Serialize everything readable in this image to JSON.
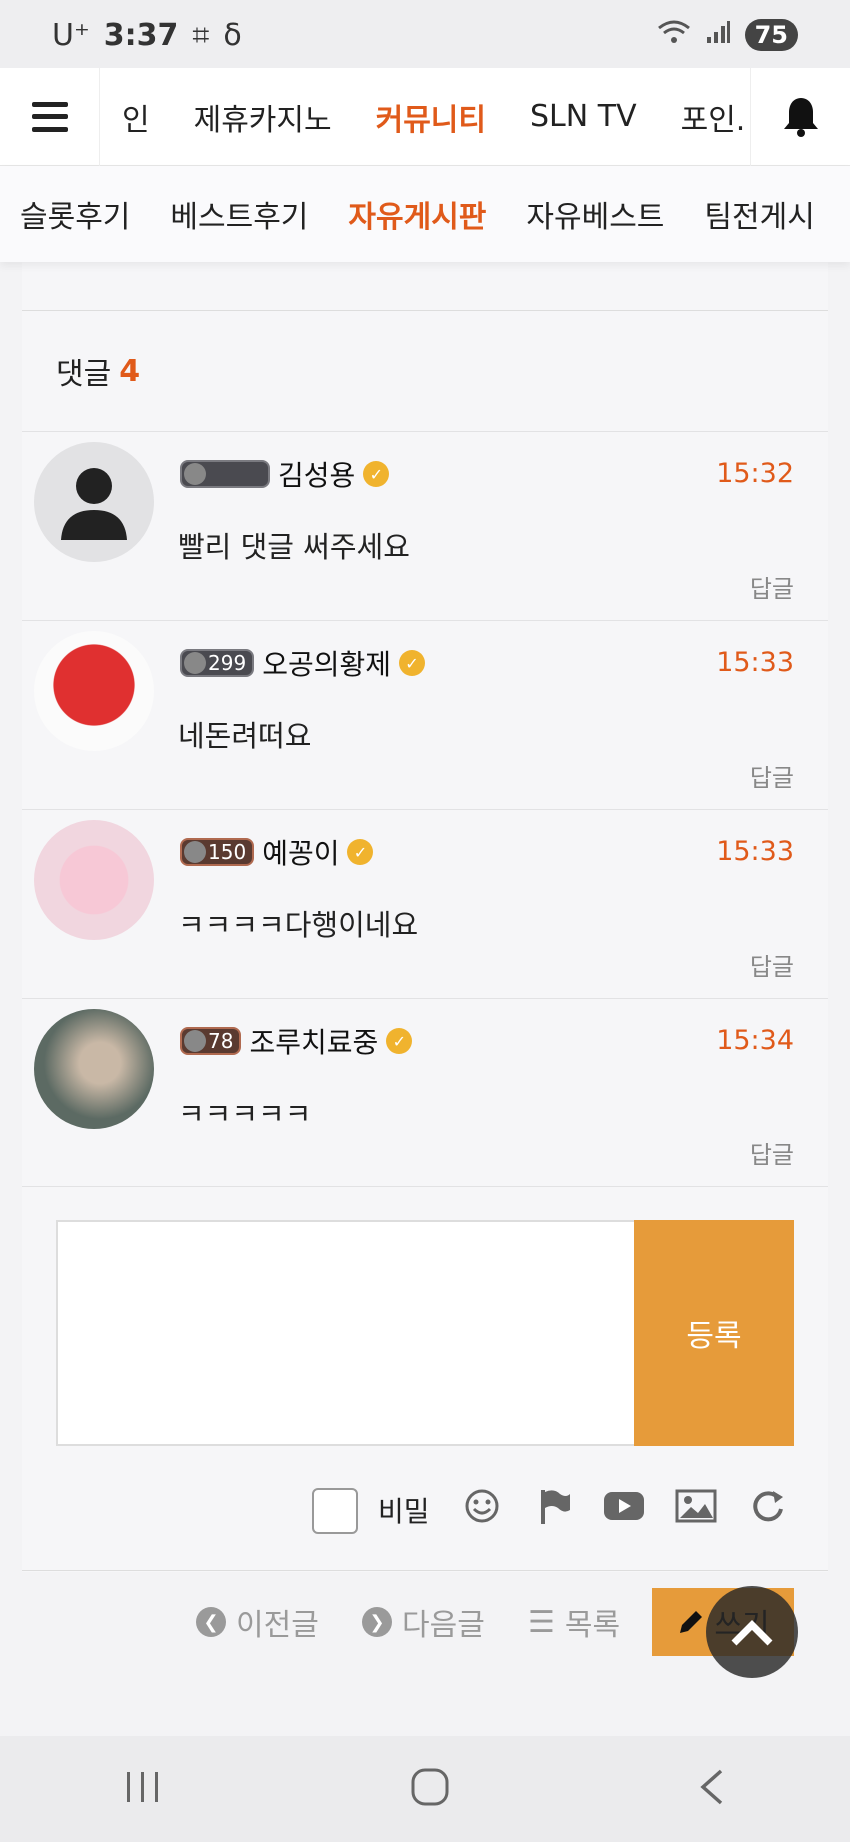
{
  "status_bar": {
    "carrier": "U⁺",
    "time": "3:37",
    "battery": "75"
  },
  "top_nav": {
    "items": [
      "인",
      "제휴카지노",
      "커뮤니티",
      "SLN TV",
      "포인."
    ],
    "active_index": 2
  },
  "sub_nav": {
    "items": [
      "슬롯후기",
      "베스트후기",
      "자유게시판",
      "자유베스트",
      "팀전게시"
    ],
    "active_index": 2
  },
  "comments": {
    "label": "댓글",
    "count": "4",
    "items": [
      {
        "level": "",
        "author": "김성용",
        "time": "15:32",
        "text": "빨리 댓글 써주세요",
        "reply": "답글"
      },
      {
        "level": "299",
        "author": "오공의황제",
        "time": "15:33",
        "text": "네돈려떠요",
        "reply": "답글"
      },
      {
        "level": "150",
        "author": "예꽁이",
        "time": "15:33",
        "text": "ㅋㅋㅋㅋ다행이네요",
        "reply": "답글"
      },
      {
        "level": "78",
        "author": "조루치료중",
        "time": "15:34",
        "text": "ㅋㅋㅋㅋㅋ",
        "reply": "답글"
      }
    ]
  },
  "comment_form": {
    "submit_label": "등록",
    "secret_label": "비밀"
  },
  "pager": {
    "prev_label": "이전글",
    "next_label": "다음글",
    "list_label": "목록",
    "write_label": "쓰기"
  },
  "colors": {
    "accent": "#e05a1a",
    "button": "#e69b3a"
  },
  "icons": [
    "menu-icon",
    "bell-icon",
    "emoji-icon",
    "flag-icon",
    "youtube-icon",
    "image-icon",
    "refresh-icon",
    "chevron-up-icon",
    "pencil-icon"
  ]
}
